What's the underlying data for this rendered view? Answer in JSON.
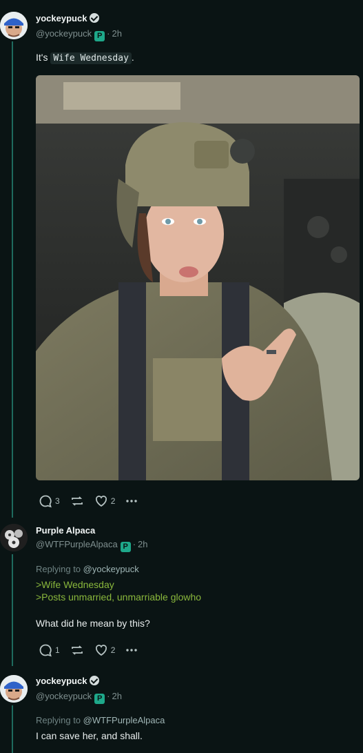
{
  "posts": [
    {
      "author": "yockeypuck",
      "handle": "@yockeypuck",
      "time": "2h",
      "text_prefix": "It's",
      "text_code": "Wife Wednesday",
      "text_suffix": ".",
      "replies": "3",
      "likes": "2"
    },
    {
      "author": "Purple Alpaca",
      "handle": "@WTFPurpleAlpaca",
      "time": "2h",
      "replying_label": "Replying to",
      "replying_to": "@yockeypuck",
      "greentext": [
        ">Wife Wednesday",
        ">Posts unmarried, unmarriable glowho"
      ],
      "text": "What did he mean by this?",
      "replies": "1",
      "likes": "2"
    },
    {
      "author": "yockeypuck",
      "handle": "@yockeypuck",
      "time": "2h",
      "replying_label": "Replying to",
      "replying_to": "@WTFPurpleAlpaca",
      "text": "I can save her, and shall."
    }
  ],
  "icons": {
    "verified": "verified-check-icon",
    "platform": "p-badge-icon",
    "reply": "reply-bubble-icon",
    "repost": "repost-icon",
    "like": "heart-icon",
    "more": "more-dots-icon"
  },
  "colors": {
    "background": "#0a1414",
    "thread": "#1e6a5e",
    "greentext": "#8ab83c",
    "badge": "#1ea88a"
  }
}
